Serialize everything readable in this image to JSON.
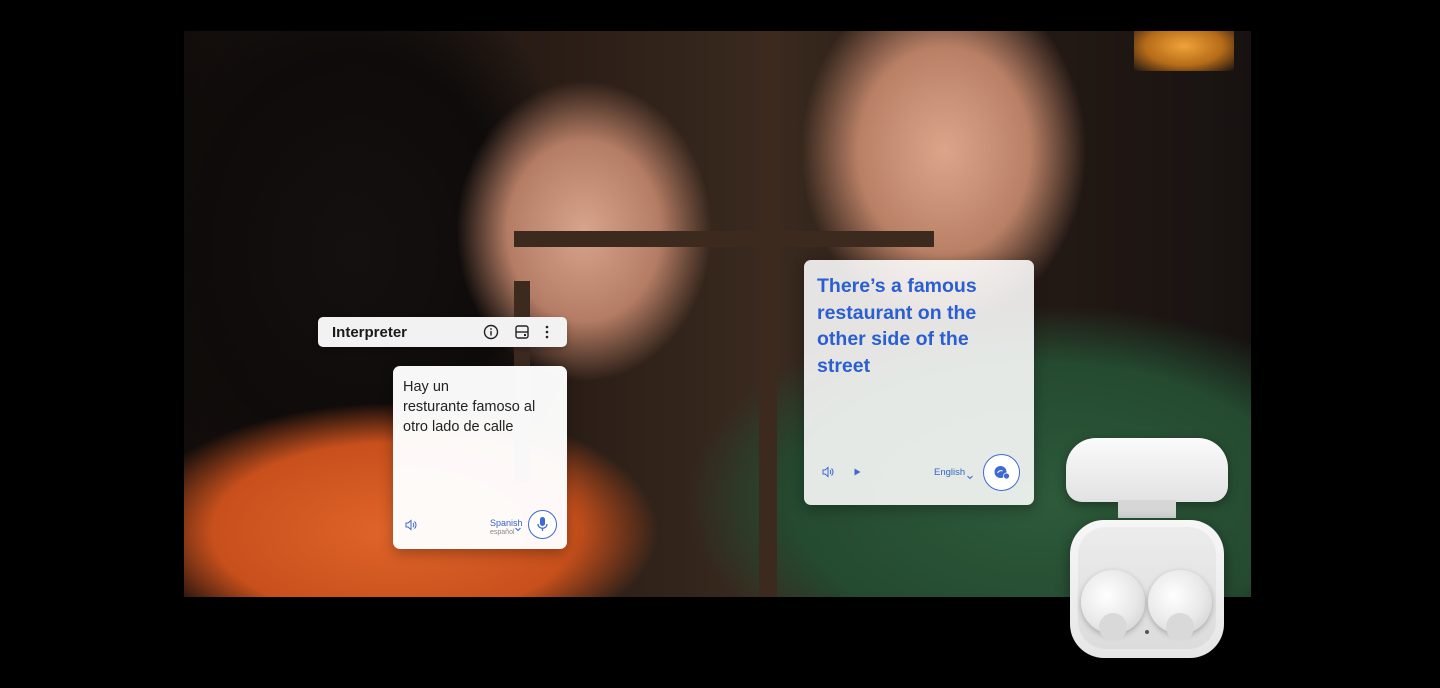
{
  "interpreter": {
    "title": "Interpreter"
  },
  "spanish_card": {
    "text": "Hay un\nresturante famoso al\notro lado de calle",
    "language": "Spanish",
    "language_native": "español"
  },
  "english_card": {
    "text": "There’s a famous restaurant on the other side of the street",
    "language": "English"
  },
  "icons": {
    "info": "info-icon",
    "layout": "layout-icon",
    "more": "more-vertical-icon",
    "speaker": "speaker-icon",
    "play": "play-icon",
    "mic": "microphone-icon",
    "chevron": "chevron-down-icon"
  },
  "colors": {
    "accent_blue": "#2b5fd1",
    "background": "#000000"
  }
}
